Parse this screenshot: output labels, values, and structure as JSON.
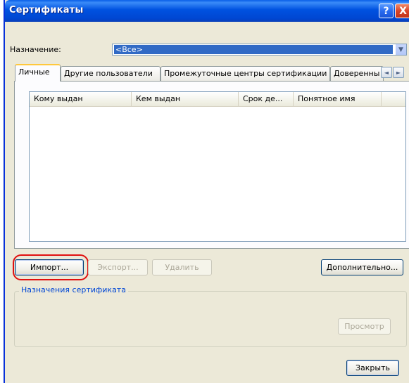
{
  "window": {
    "title": "Сертификаты"
  },
  "titlebar": {
    "help": "?",
    "close": "X"
  },
  "purpose": {
    "label": "Назначение:",
    "selected": "<Все>"
  },
  "tabs": [
    {
      "label": "Личные",
      "active": true
    },
    {
      "label": "Другие пользователи",
      "active": false
    },
    {
      "label": "Промежуточные центры сертификации",
      "active": false
    },
    {
      "label": "Доверенны",
      "active": false
    }
  ],
  "tab_scroll": {
    "left": "◄",
    "right": "►"
  },
  "list": {
    "columns": [
      "Кому выдан",
      "Кем выдан",
      "Срок де...",
      "Понятное имя"
    ],
    "rows": []
  },
  "buttons": {
    "import": "Импорт...",
    "export": "Экспорт...",
    "delete": "Удалить",
    "advanced": "Дополнительно...",
    "view": "Просмотр",
    "close": "Закрыть"
  },
  "group": {
    "title": "Назначения сертификата"
  },
  "colors": {
    "titlebar": "#0052e0",
    "window": "#ece9d8",
    "highlight": "#e01010",
    "selection": "#316ac5"
  }
}
